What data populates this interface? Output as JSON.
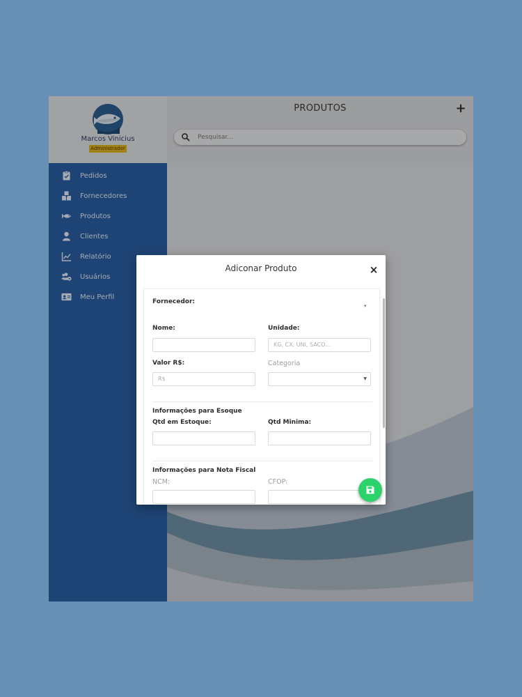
{
  "sidebar": {
    "user_name": "Marcos Vinicius",
    "user_role": "Administrador",
    "items": [
      {
        "label": "Pedidos",
        "icon": "clipboard-check-icon"
      },
      {
        "label": "Fornecedores",
        "icon": "boxes-icon"
      },
      {
        "label": "Produtos",
        "icon": "fish-icon"
      },
      {
        "label": "Clientes",
        "icon": "user-icon"
      },
      {
        "label": "Relatório",
        "icon": "chart-line-icon"
      },
      {
        "label": "Usuários",
        "icon": "users-cog-icon"
      },
      {
        "label": "Meu Perfil",
        "icon": "id-card-icon"
      }
    ]
  },
  "header": {
    "title": "PRODUTOS",
    "add_label": "+",
    "search_placeholder": "Pesquisar..."
  },
  "modal": {
    "title": "Adiconar Produto",
    "close_label": "×",
    "fornecedor_label": "Fornecedor:",
    "nome_label": "Nome:",
    "unidade_label": "Unidade:",
    "unidade_placeholder": "KG, CX, UNI, SACO...",
    "valor_label": "Valor R$:",
    "valor_placeholder": "R$",
    "categoria_label": "Categoria",
    "estoque_section": "Informações para Esoque",
    "qtd_estoque_label": "Qtd em Estoque:",
    "qtd_minima_label": "Qtd Minima:",
    "nota_section": "Informações para Nota Fiscal",
    "ncm_label": "NCM:",
    "cfop_label": "CFOP:"
  },
  "colors": {
    "background": "#6790b4",
    "sidebar": "#2a5fa2",
    "role_badge": "#e0b222",
    "fab": "#2bd36a"
  }
}
